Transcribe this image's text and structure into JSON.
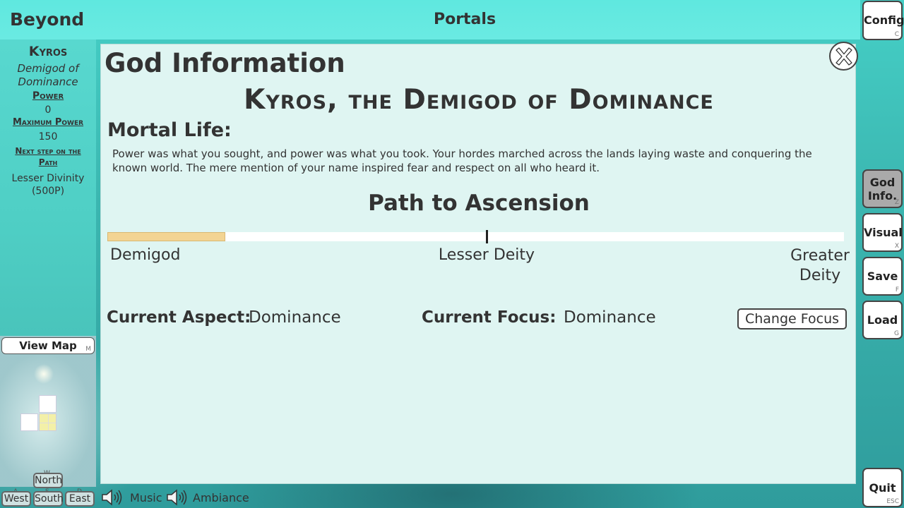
{
  "header": {
    "game_title": "Beyond",
    "location_title": "Portals"
  },
  "left_panel": {
    "god_name": "Kyros",
    "god_title": "Demigod of Dominance",
    "power_label": "Power",
    "power_value": "0",
    "max_power_label": "Maximum Power",
    "max_power_value": "150",
    "next_step_label": "Next step on the Path",
    "next_step_value": "Lesser Divinity (500P)"
  },
  "map": {
    "view_map_label": "View Map",
    "view_map_hotkey": "M",
    "directions": {
      "north": {
        "label": "North",
        "hotkey": "W"
      },
      "west": {
        "label": "West",
        "hotkey": "A"
      },
      "south": {
        "label": "South",
        "hotkey": "S"
      },
      "east": {
        "label": "East",
        "hotkey": "D"
      }
    }
  },
  "audio": {
    "music_label": "Music",
    "ambiance_label": "Ambiance"
  },
  "side_buttons": {
    "config": {
      "label": "Config",
      "hotkey": "C"
    },
    "god_info": {
      "label_line1": "God",
      "label_line2": "Info.",
      "hotkey": "Z"
    },
    "visual": {
      "label": "Visual",
      "hotkey": "X"
    },
    "save": {
      "label": "Save",
      "hotkey": "F"
    },
    "load": {
      "label": "Load",
      "hotkey": "G"
    },
    "quit": {
      "label": "Quit",
      "hotkey": "ESC"
    }
  },
  "modal": {
    "title": "God Information",
    "god_fullname": "Kyros, the Demigod of Dominance",
    "mortal_life_heading": "Mortal Life:",
    "mortal_life_text": "Power was what you sought, and power was what you took. Your hordes marched across the lands laying waste and conquering the known world. The mere mention of your name inspired fear and respect on all who heard it.",
    "ascension_heading": "Path to Ascension",
    "ascension_progress": 0.16,
    "stages": [
      "Demigod",
      "Lesser Deity",
      "Greater Deity"
    ],
    "current_aspect_label": "Current Aspect:",
    "current_aspect_value": "Dominance",
    "current_focus_label": "Current Focus:",
    "current_focus_value": "Dominance",
    "change_focus_label": "Change Focus"
  },
  "colors": {
    "progress_fill": "#f3d493",
    "panel_bg": "#dff5f2",
    "active_side_button": "#aaaaaa",
    "current_map_cell": "#f3f0a8"
  }
}
